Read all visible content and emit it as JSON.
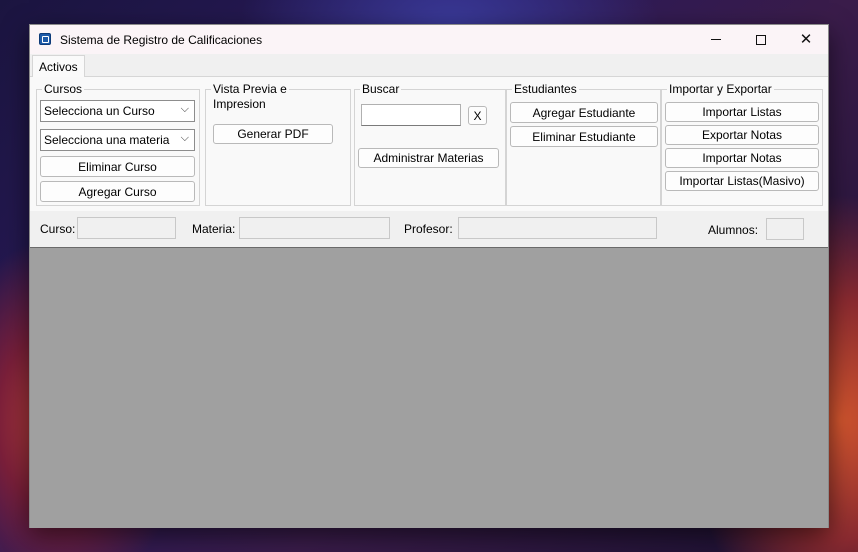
{
  "window": {
    "title": "Sistema de Registro de Calificaciones",
    "close_glyph": "✕"
  },
  "tabs": [
    {
      "label": "Activos"
    }
  ],
  "groups": {
    "cursos": {
      "title": "Cursos",
      "curso_combo": "Selecciona un Curso",
      "materia_combo": "Selecciona una materia",
      "eliminar": "Eliminar Curso",
      "agregar": "Agregar Curso"
    },
    "vista": {
      "title_line1": "Vista Previa e",
      "title_line2": "Impresion",
      "generar": "Generar PDF"
    },
    "buscar": {
      "title": "Buscar",
      "search_value": "",
      "clear": "X",
      "administrar": "Administrar Materias"
    },
    "estudiantes": {
      "title": "Estudiantes",
      "agregar": "Agregar Estudiante",
      "eliminar": "Eliminar Estudiante"
    },
    "importar": {
      "title": "Importar y Exportar",
      "importar_listas": "Importar Listas",
      "exportar_notas": "Exportar Notas",
      "importar_notas": "Importar Notas",
      "importar_masivo": "Importar Listas(Masivo)"
    }
  },
  "info": {
    "curso_label": "Curso:",
    "curso_value": "",
    "materia_label": "Materia:",
    "materia_value": "",
    "profesor_label": "Profesor:",
    "profesor_value": "",
    "alumnos_label": "Alumnos:",
    "alumnos_value": ""
  },
  "icons": {
    "chevron": "⌵"
  }
}
